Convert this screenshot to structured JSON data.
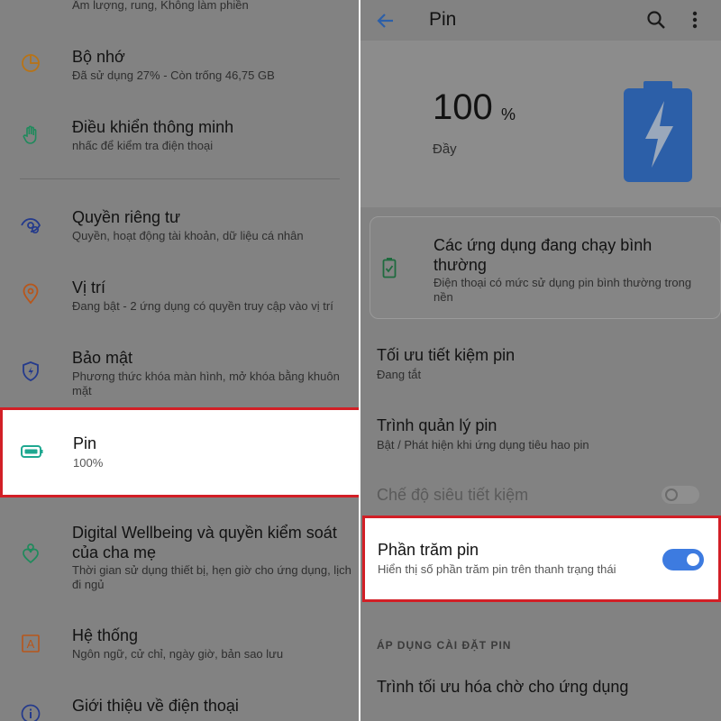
{
  "left": {
    "items": [
      {
        "title": "",
        "sub": "Âm lượng, rung, Không làm phiền"
      },
      {
        "title": "Bộ nhớ",
        "sub": "Đã sử dụng 27% - Còn trống 46,75 GB"
      },
      {
        "title": "Điều khiển thông minh",
        "sub": "nhấc để kiểm tra điện thoại"
      },
      {
        "title": "Quyền riêng tư",
        "sub": "Quyền, hoạt động tài khoản, dữ liệu cá nhân"
      },
      {
        "title": "Vị trí",
        "sub": "Đang bật - 2 ứng dụng có quyền truy cập vào vị trí"
      },
      {
        "title": "Bảo mật",
        "sub": "Phương thức khóa màn hình, mở khóa bằng khuôn mặt"
      },
      {
        "title": "Pin",
        "sub": "100%"
      },
      {
        "title": "Digital Wellbeing và quyền kiểm soát của cha mẹ",
        "sub": "Thời gian sử dụng thiết bị, hẹn giờ cho ứng dụng, lịch đi ngủ"
      },
      {
        "title": "Hệ thống",
        "sub": "Ngôn ngữ, cử chỉ, ngày giờ, bản sao lưu"
      },
      {
        "title": "Giới thiệu về điện thoại",
        "sub": ""
      }
    ]
  },
  "right": {
    "appbar": {
      "title": "Pin"
    },
    "hero": {
      "level": "100",
      "unit": "%",
      "status": "Đầy"
    },
    "card": {
      "title": "Các ứng dụng đang chạy bình thường",
      "sub": "Điện thoại có mức sử dụng pin bình thường trong nền"
    },
    "items": [
      {
        "title": "Tối ưu tiết kiệm pin",
        "sub": "Đang tắt"
      },
      {
        "title": "Trình quản lý pin",
        "sub": "Bật / Phát hiện khi ứng dụng tiêu hao pin"
      },
      {
        "title": "Chế độ siêu tiết kiệm",
        "sub": ""
      },
      {
        "title": "Phần trăm pin",
        "sub": "Hiển thị số phần trăm pin trên thanh trạng thái"
      },
      {
        "title": "Trình tối ưu hóa chờ cho ứng dụng",
        "sub": ""
      }
    ],
    "section_header": "ÁP DỤNG CÀI ĐẶT PIN"
  },
  "colors": {
    "accent": "#3d7be0",
    "highlight": "#d21f26",
    "battery": "#2c5fa8",
    "teal": "#1fa891"
  }
}
